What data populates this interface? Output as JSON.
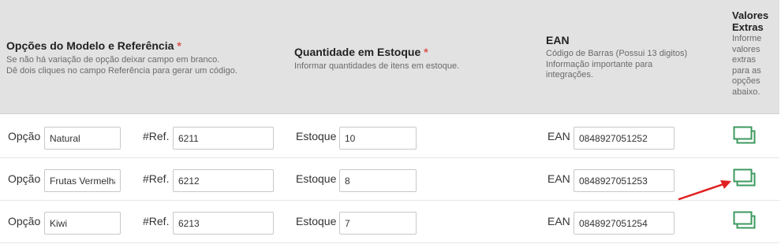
{
  "header": {
    "col_option": {
      "title": "Opções do Modelo e Referência",
      "required": "*",
      "help1": "Se não há variação de opção deixar campo em branco.",
      "help2": "Dê dois cliques no campo Referência para gerar um código."
    },
    "col_stock": {
      "title": "Quantidade em Estoque",
      "required": "*",
      "help1": "Informar quantidades de itens em estoque."
    },
    "col_ean": {
      "title": "EAN",
      "help1": "Código de Barras (Possui 13 digitos)",
      "help2": "Informação importante para",
      "help3": "integrações."
    },
    "col_extras": {
      "title1": "Valores",
      "title2": "Extras",
      "help1": "Informe",
      "help2": "valores",
      "help3": "extras",
      "help4": "para as",
      "help5": "opções",
      "help6": "abaixo."
    }
  },
  "labels": {
    "option": "Opção",
    "ref": "#Ref.",
    "stock": "Estoque",
    "ean": "EAN"
  },
  "rows": [
    {
      "option": "Natural",
      "ref": "6211",
      "stock": "10",
      "ean": "0848927051252"
    },
    {
      "option": "Frutas Vermelhas",
      "ref": "6212",
      "stock": "8",
      "ean": "0848927051253"
    },
    {
      "option": "Kiwi",
      "ref": "6213",
      "stock": "7",
      "ean": "0848927051254"
    }
  ],
  "icons": {
    "extras": "extra-values-icon",
    "annotation": "red-arrow-icon"
  },
  "colors": {
    "header_bg": "#e2e2e2",
    "required": "#d9534f",
    "icon_green": "#3c9a5f",
    "arrow_red": "#e02020"
  }
}
